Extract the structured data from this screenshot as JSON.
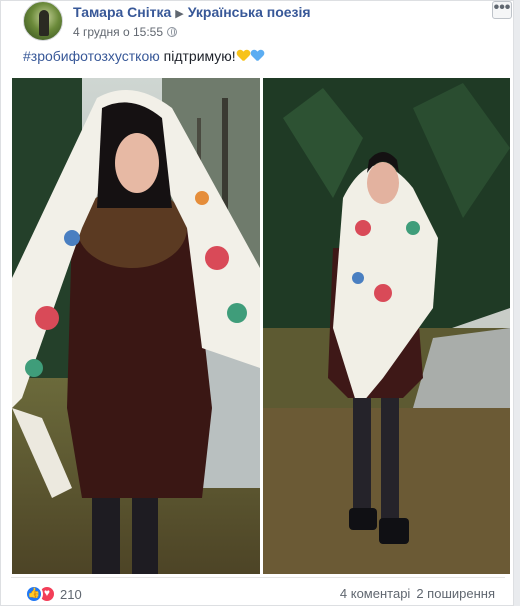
{
  "author": {
    "name": "Тамара Снітка",
    "group": "Українська поезія",
    "arrow": "▶"
  },
  "timestamp": "4 грудня о 15:55",
  "post": {
    "hashtag": "#зробифотозхусткою",
    "text": " підтримую!"
  },
  "more_button": "•••",
  "photos": [
    {
      "subject": "woman in floral white shawl with fur collar and brown coat"
    },
    {
      "subject": "woman in floral white shawl standing by a pine tree"
    }
  ],
  "reactions": {
    "count": "210",
    "types": [
      "like",
      "love"
    ]
  },
  "stats": {
    "comments": "4 коментарі",
    "shares": "2 поширення"
  },
  "colors": {
    "link": "#385898",
    "muted": "#606770",
    "like": "#2078f4",
    "love": "#f33e58"
  }
}
